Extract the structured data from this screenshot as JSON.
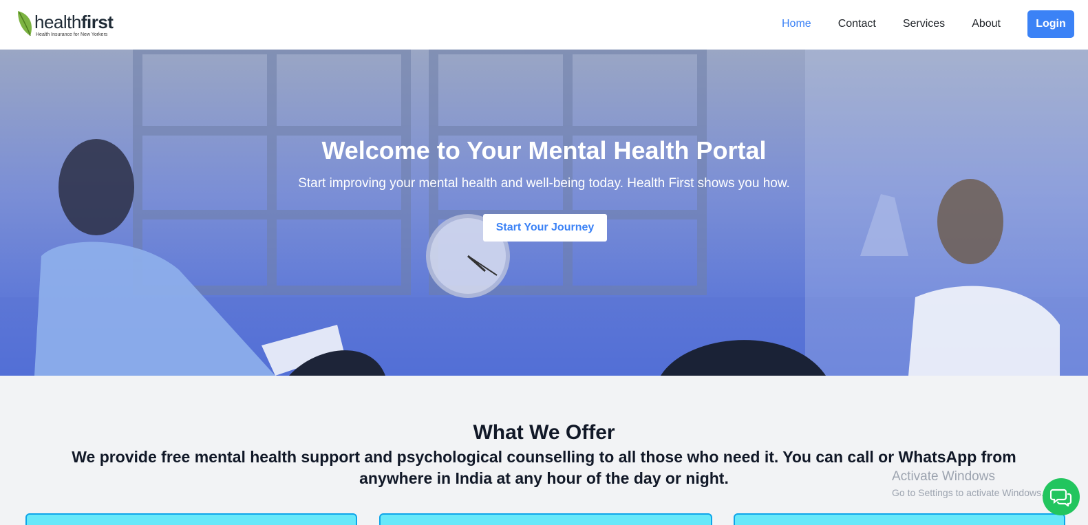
{
  "logo": {
    "brand_light": "health",
    "brand_bold": "first",
    "tagline": "Health Insurance for New Yorkers"
  },
  "nav": {
    "items": [
      {
        "label": "Home",
        "active": true
      },
      {
        "label": "Contact",
        "active": false
      },
      {
        "label": "Services",
        "active": false
      },
      {
        "label": "About",
        "active": false
      }
    ],
    "login_label": "Login"
  },
  "hero": {
    "title": "Welcome to Your Mental Health Portal",
    "subtitle": "Start improving your mental health and well-being today. Health First shows you how.",
    "cta_label": "Start Your Journey"
  },
  "offer": {
    "title": "What We Offer",
    "description": "We provide free mental health support and psychological counselling to all those who need it. You can call or WhatsApp from anywhere in India at any hour of the day or night."
  },
  "watermark": {
    "title": "Activate Windows",
    "subtitle": "Go to Settings to activate Windows."
  },
  "colors": {
    "accent": "#3b82f6",
    "chat": "#22c55e",
    "card": "#67e8f9",
    "hero_overlay": "#4b6ad8"
  },
  "icons": {
    "logo": "leaf-icon",
    "chat": "chat-bubbles-icon"
  }
}
